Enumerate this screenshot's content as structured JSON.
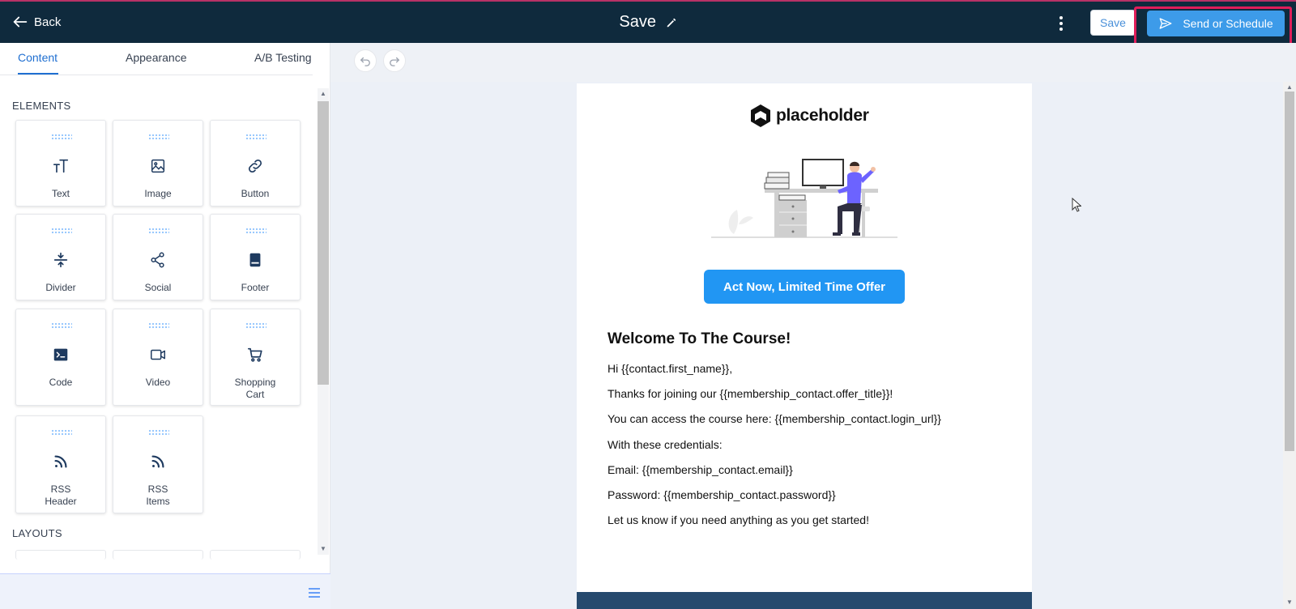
{
  "topbar": {
    "back_label": "Back",
    "title": "Save",
    "save_label": "Save",
    "send_label": "Send or Schedule"
  },
  "left_panel": {
    "tabs": [
      {
        "label": "Content"
      },
      {
        "label": "Appearance"
      },
      {
        "label": "A/B Testing"
      }
    ],
    "elements_label": "ELEMENTS",
    "layouts_label": "LAYOUTS",
    "elements": [
      {
        "label": "Text",
        "icon": "text-icon"
      },
      {
        "label": "Image",
        "icon": "image-icon"
      },
      {
        "label": "Button",
        "icon": "link-icon"
      },
      {
        "label": "Divider",
        "icon": "divider-icon"
      },
      {
        "label": "Social",
        "icon": "share-icon"
      },
      {
        "label": "Footer",
        "icon": "footer-icon"
      },
      {
        "label": "Code",
        "icon": "code-icon"
      },
      {
        "label": "Video",
        "icon": "video-icon"
      },
      {
        "label": "Shopping\nCart",
        "icon": "cart-icon"
      },
      {
        "label": "RSS\nHeader",
        "icon": "rss-icon"
      },
      {
        "label": "RSS\nItems",
        "icon": "rss-icon"
      }
    ]
  },
  "email": {
    "logo_text": "placeholder",
    "cta_label": "Act Now, Limited Time Offer",
    "heading": "Welcome To The Course!",
    "lines": [
      "Hi {{contact.first_name}},",
      "Thanks for joining our {{membership_contact.offer_title}}!",
      "You can access the course here: {{membership_contact.login_url}}",
      "With these credentials:",
      "Email: {{membership_contact.email}}",
      "Password: {{membership_contact.password}}",
      "Let us know if you need anything as you get started!"
    ]
  },
  "colors": {
    "topbar": "#0f2a3d",
    "accent": "#3d9be9",
    "highlight": "#e01e5a",
    "cta": "#2196f3"
  }
}
